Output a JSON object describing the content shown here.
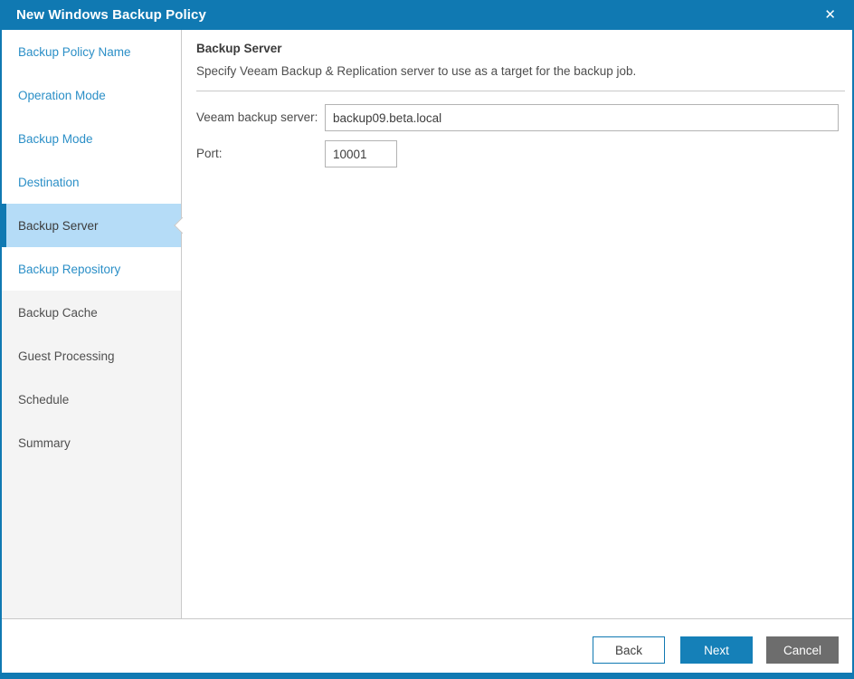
{
  "window": {
    "title": "New Windows Backup Policy",
    "close_icon": "✕"
  },
  "colors": {
    "titlebar_blue": "#1079b2",
    "link_blue": "#2b8fc7",
    "selected_bg": "#b5dcf7",
    "future_bg": "#f4f4f4",
    "divider_gray": "#c9c9c9",
    "input_border": "#b3b3b3",
    "next_button_bg": "#1580b8",
    "cancel_button_bg": "#6d6d6d",
    "text_dark": "#3c3c3c"
  },
  "sidebar": {
    "items": [
      {
        "label": "Backup Policy Name",
        "state": "visited"
      },
      {
        "label": "Operation Mode",
        "state": "visited"
      },
      {
        "label": "Backup Mode",
        "state": "visited"
      },
      {
        "label": "Destination",
        "state": "visited"
      },
      {
        "label": "Backup Server",
        "state": "current"
      },
      {
        "label": "Backup Repository",
        "state": "visited"
      },
      {
        "label": "Backup Cache",
        "state": "future"
      },
      {
        "label": "Guest Processing",
        "state": "future"
      },
      {
        "label": "Schedule",
        "state": "future"
      },
      {
        "label": "Summary",
        "state": "future"
      }
    ]
  },
  "content": {
    "heading": "Backup Server",
    "description": "Specify Veeam Backup & Replication server to use as a target for the backup job.",
    "fields": [
      {
        "label": "Veeam backup server:",
        "value": "backup09.beta.local"
      },
      {
        "label": "Port:",
        "value": "10001"
      }
    ]
  },
  "footer": {
    "back_label": "Back",
    "next_label": "Next",
    "cancel_label": "Cancel"
  }
}
